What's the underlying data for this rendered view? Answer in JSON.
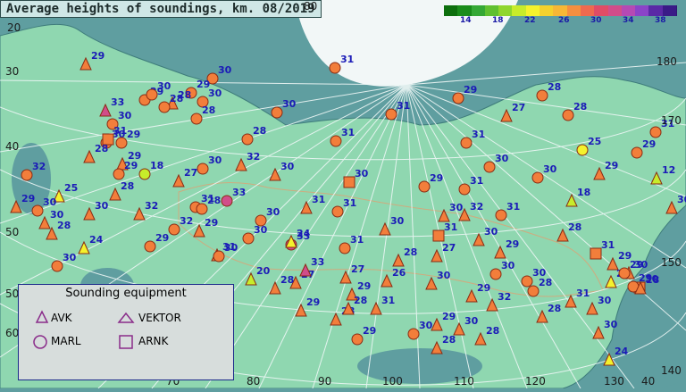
{
  "title": "Average heights of soundings, km. 08/2019",
  "scale": {
    "labels": [
      "14",
      "18",
      "22",
      "26",
      "30",
      "34",
      "38"
    ],
    "colors": [
      "#0d6f0d",
      "#1a8c1a",
      "#35a835",
      "#60c030",
      "#8fd62d",
      "#c7ec2b",
      "#f4f22d",
      "#f4d12d",
      "#f7b736",
      "#f58f3f",
      "#ef6a4f",
      "#e04c66",
      "#d14d8a",
      "#b54ab4",
      "#8b44c8",
      "#5a2aa6",
      "#3a1b87"
    ]
  },
  "legend": {
    "title": "Sounding equipment",
    "items": [
      {
        "label": "AVK",
        "shape": "triangle"
      },
      {
        "label": "VEKTOR",
        "shape": "triangle"
      },
      {
        "label": "MARL",
        "shape": "circle"
      },
      {
        "label": "ARNK",
        "shape": "square"
      }
    ]
  },
  "grid_labels": [
    "80",
    "180",
    "170",
    "150",
    "140",
    "130",
    "120",
    "110",
    "100",
    "90",
    "80",
    "70",
    "60",
    "50",
    "40",
    "30",
    "20",
    "40",
    "50"
  ],
  "stations": [
    {
      "shape": "triangle",
      "value": "29"
    },
    {
      "shape": "circle",
      "value": "31"
    },
    {
      "shape": "circle",
      "value": "30"
    },
    {
      "shape": "circle",
      "value": "29"
    },
    {
      "shape": "circle",
      "value": "29"
    },
    {
      "shape": "triangle",
      "value": "28"
    },
    {
      "shape": "triangle",
      "value": "33"
    },
    {
      "shape": "circle",
      "value": "30"
    },
    {
      "shape": "circle",
      "value": "30"
    },
    {
      "shape": "circle",
      "value": "28"
    },
    {
      "shape": "circle",
      "value": "30"
    },
    {
      "shape": "circle",
      "value": "28"
    },
    {
      "shape": "circle",
      "value": "30"
    },
    {
      "shape": "circle",
      "value": "31"
    },
    {
      "shape": "circle",
      "value": "29"
    },
    {
      "shape": "circle",
      "value": "28"
    },
    {
      "shape": "triangle",
      "value": "27"
    },
    {
      "shape": "circle",
      "value": "28"
    },
    {
      "shape": "circle",
      "value": "25"
    },
    {
      "shape": "circle",
      "value": "31"
    },
    {
      "shape": "circle",
      "value": "31"
    },
    {
      "shape": "circle",
      "value": "29"
    },
    {
      "shape": "circle",
      "value": "31"
    },
    {
      "shape": "circle",
      "value": "28"
    },
    {
      "shape": "circle",
      "value": "30"
    },
    {
      "shape": "circle",
      "value": "29"
    },
    {
      "shape": "square",
      "value": "31"
    },
    {
      "shape": "triangle",
      "value": "28"
    },
    {
      "shape": "triangle",
      "value": "29"
    },
    {
      "shape": "circle",
      "value": "18"
    },
    {
      "shape": "triangle",
      "value": "27"
    },
    {
      "shape": "circle",
      "value": "30"
    },
    {
      "shape": "triangle",
      "value": "32"
    },
    {
      "shape": "triangle",
      "value": "30"
    },
    {
      "shape": "square",
      "value": "30"
    },
    {
      "shape": "circle",
      "value": "29"
    },
    {
      "shape": "circle",
      "value": "31"
    },
    {
      "shape": "triangle",
      "value": "28"
    },
    {
      "shape": "triangle",
      "value": "32"
    },
    {
      "shape": "triangle",
      "value": "30"
    },
    {
      "shape": "triangle",
      "value": "28"
    },
    {
      "shape": "circle",
      "value": "30"
    },
    {
      "shape": "triangle",
      "value": "24"
    },
    {
      "shape": "circle",
      "value": "29"
    },
    {
      "shape": "circle",
      "value": "32"
    },
    {
      "shape": "triangle",
      "value": "29"
    },
    {
      "shape": "circle",
      "value": "30"
    },
    {
      "shape": "circle",
      "value": "33"
    },
    {
      "shape": "circle",
      "value": "33"
    },
    {
      "shape": "triangle",
      "value": "31"
    },
    {
      "shape": "circle",
      "value": "30"
    },
    {
      "shape": "circle",
      "value": "31"
    },
    {
      "shape": "triangle",
      "value": "30"
    },
    {
      "shape": "square",
      "value": "31"
    },
    {
      "shape": "circle",
      "value": "31"
    },
    {
      "shape": "circle",
      "value": "30"
    },
    {
      "shape": "circle",
      "value": "30"
    },
    {
      "shape": "triangle",
      "value": "18"
    },
    {
      "shape": "triangle",
      "value": "29"
    },
    {
      "shape": "triangle",
      "value": "12"
    },
    {
      "shape": "triangle",
      "value": "30"
    },
    {
      "shape": "triangle",
      "value": "28"
    },
    {
      "shape": "square",
      "value": "31"
    },
    {
      "shape": "triangle",
      "value": "29"
    },
    {
      "shape": "triangle",
      "value": "30"
    },
    {
      "shape": "square",
      "value": "30"
    },
    {
      "shape": "triangle",
      "value": "30"
    },
    {
      "shape": "triangle",
      "value": "31"
    },
    {
      "shape": "triangle",
      "value": "28"
    },
    {
      "shape": "triangle",
      "value": "30"
    },
    {
      "shape": "triangle",
      "value": "24"
    },
    {
      "shape": "triangle",
      "value": "27"
    },
    {
      "shape": "triangle",
      "value": "29"
    },
    {
      "shape": "triangle",
      "value": "28"
    },
    {
      "shape": "triangle",
      "value": "27"
    },
    {
      "shape": "triangle",
      "value": "29"
    },
    {
      "shape": "triangle",
      "value": "31"
    },
    {
      "shape": "triangle",
      "value": "26"
    },
    {
      "shape": "triangle",
      "value": "28"
    },
    {
      "shape": "triangle",
      "value": "30"
    },
    {
      "shape": "triangle",
      "value": "27"
    },
    {
      "shape": "triangle",
      "value": "29"
    },
    {
      "shape": "triangle",
      "value": "32"
    },
    {
      "shape": "triangle",
      "value": "29"
    },
    {
      "shape": "triangle",
      "value": "30"
    },
    {
      "shape": "triangle",
      "value": "28"
    },
    {
      "shape": "triangle",
      "value": "29"
    },
    {
      "shape": "triangle",
      "value": "30"
    },
    {
      "shape": "triangle",
      "value": "32"
    },
    {
      "shape": "circle",
      "value": "31"
    },
    {
      "shape": "triangle",
      "value": "30"
    },
    {
      "shape": "circle",
      "value": "29"
    },
    {
      "shape": "circle",
      "value": "31"
    },
    {
      "shape": "triangle",
      "value": "28"
    },
    {
      "shape": "triangle",
      "value": "33"
    },
    {
      "shape": "triangle",
      "value": "28"
    },
    {
      "shape": "circle",
      "value": "30"
    },
    {
      "shape": "circle",
      "value": "29"
    },
    {
      "shape": "triangle",
      "value": "28"
    },
    {
      "shape": "triangle",
      "value": "31"
    },
    {
      "shape": "triangle",
      "value": "24"
    },
    {
      "shape": "triangle",
      "value": "20"
    },
    {
      "shape": "circle",
      "value": "32"
    },
    {
      "shape": "triangle",
      "value": "29"
    },
    {
      "shape": "triangle",
      "value": "25"
    },
    {
      "shape": "triangle",
      "value": "30"
    },
    {
      "shape": "circle",
      "value": "30"
    },
    {
      "shape": "circle",
      "value": "28"
    },
    {
      "shape": "circle",
      "value": "30"
    },
    {
      "shape": "circle",
      "value": "30"
    },
    {
      "shape": "circle",
      "value": "28"
    },
    {
      "shape": "circle",
      "value": "30"
    },
    {
      "shape": "triangle",
      "value": "24"
    },
    {
      "shape": "circle",
      "value": "29"
    },
    {
      "shape": "circle",
      "value": "29"
    },
    {
      "shape": "triangle",
      "value": "28"
    }
  ],
  "colors": {
    "ocean": "#5f9ea0",
    "land": "#8fd7b0",
    "ice": "#f2f7f7",
    "grid": "#e9f2f1",
    "marker_fill": "#f27e3b",
    "marker_stroke": "#8a2c14",
    "label": "#1b1bb7"
  }
}
